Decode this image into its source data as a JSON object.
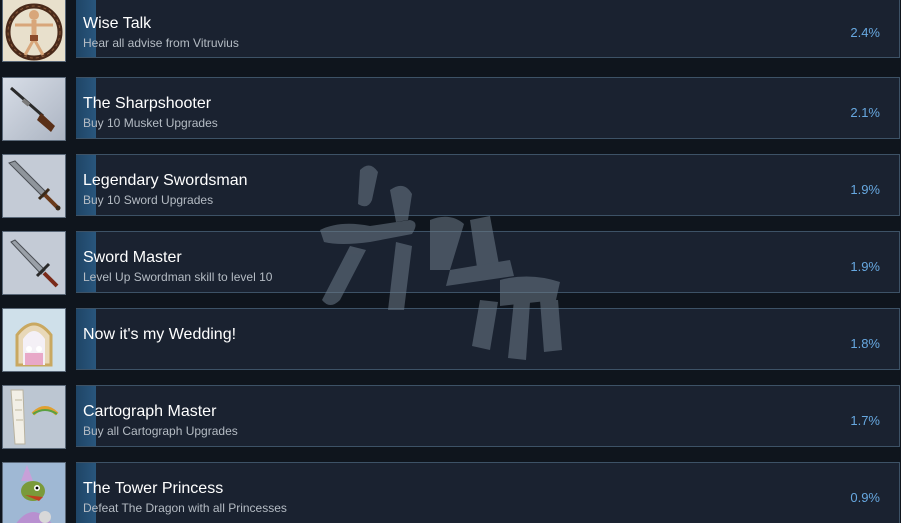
{
  "achievements": [
    {
      "title": "Wise Talk",
      "description": "Hear all advise from Vitruvius",
      "percent": "2.4%",
      "icon": "vitruvian-man-icon"
    },
    {
      "title": "The Sharpshooter",
      "description": "Buy 10 Musket Upgrades",
      "percent": "2.1%",
      "icon": "musket-icon"
    },
    {
      "title": "Legendary Swordsman",
      "description": "Buy 10 Sword Upgrades",
      "percent": "1.9%",
      "icon": "broadsword-icon"
    },
    {
      "title": "Sword Master",
      "description": "Level Up Swordman skill to level 10",
      "percent": "1.9%",
      "icon": "sword-icon"
    },
    {
      "title": "Now it's my Wedding!",
      "description": "",
      "percent": "1.8%",
      "icon": "wedding-arch-icon"
    },
    {
      "title": "Cartograph Master",
      "description": "Buy all Cartograph Upgrades",
      "percent": "1.7%",
      "icon": "map-scroll-icon"
    },
    {
      "title": "The Tower Princess",
      "description": "Defeat The Dragon with all Princesses",
      "percent": "0.9%",
      "icon": "dragon-princess-icon"
    }
  ],
  "colors": {
    "background": "#0f151d",
    "card": "#1a2230",
    "card_border": "#3d5266",
    "progress": "#29567d",
    "percent_text": "#67a8e0"
  }
}
